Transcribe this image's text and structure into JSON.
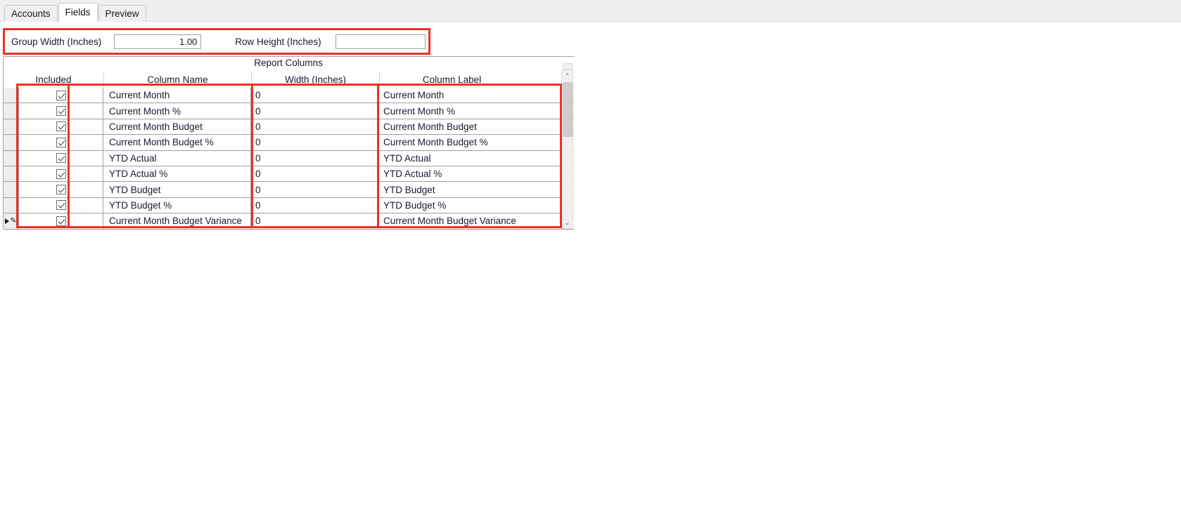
{
  "window": {
    "background_color": "#ffffff",
    "tabstrip_color": "#efefef",
    "highlight_color": "#ee3124"
  },
  "tabs": [
    {
      "label": "Accounts",
      "active": false
    },
    {
      "label": "Fields",
      "active": true
    },
    {
      "label": "Preview",
      "active": false
    }
  ],
  "params": {
    "group_width": {
      "label": "Group Width (Inches)",
      "value": "1.00",
      "placeholder": ""
    },
    "row_height": {
      "label": "Row Height (Inches)",
      "value": "",
      "placeholder": ""
    }
  },
  "grid": {
    "caption": "Report Columns",
    "headers": [
      "Included",
      "Column Name",
      "Width (Inches)",
      "Column Label"
    ],
    "rows": [
      {
        "included": true,
        "column_name": "Current Month",
        "width": "0",
        "column_label": "Current Month",
        "current": false
      },
      {
        "included": true,
        "column_name": "Current Month %",
        "width": "0",
        "column_label": "Current Month %",
        "current": false
      },
      {
        "included": true,
        "column_name": "Current Month Budget",
        "width": "0",
        "column_label": "Current Month Budget",
        "current": false
      },
      {
        "included": true,
        "column_name": "Current Month Budget %",
        "width": "0",
        "column_label": "Current Month Budget %",
        "current": false
      },
      {
        "included": true,
        "column_name": "YTD Actual",
        "width": "0",
        "column_label": "YTD Actual",
        "current": false
      },
      {
        "included": true,
        "column_name": "YTD Actual %",
        "width": "0",
        "column_label": "YTD Actual %",
        "current": false
      },
      {
        "included": true,
        "column_name": "YTD Budget",
        "width": "0",
        "column_label": "YTD Budget",
        "current": false
      },
      {
        "included": true,
        "column_name": "YTD Budget %",
        "width": "0",
        "column_label": "YTD Budget %",
        "current": false
      },
      {
        "included": true,
        "column_name": "Current Month Budget Variance",
        "width": "0",
        "column_label": "Current Month Budget Variance",
        "current": true
      }
    ],
    "row_indicator": {
      "arrow_icon": "row-current-arrow-icon",
      "pencil_icon": "row-edit-pencil-icon",
      "pencil_glyph": "✎"
    },
    "scrollbar": {
      "up_glyph": "⌃",
      "down_glyph": "⌄",
      "thumb_position_percent": 0
    }
  }
}
